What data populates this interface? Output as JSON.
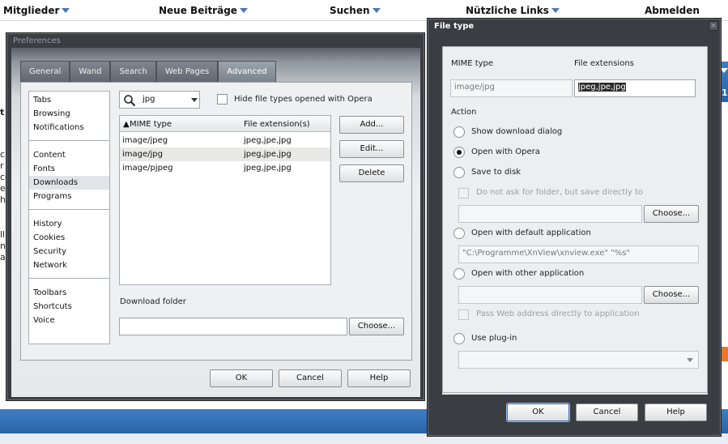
{
  "forum": {
    "nav": [
      "Mitglieder",
      "Neue Beiträge",
      "Suchen",
      "Nützliche Links",
      "Abmelden"
    ],
    "side_fragments": [
      "t",
      "ci",
      "r",
      "ce",
      "er",
      "he",
      "ll",
      "ni",
      "a"
    ],
    "right_number": "1"
  },
  "preferences": {
    "title": "Preferences",
    "tabs": [
      "General",
      "Wand",
      "Search",
      "Web Pages",
      "Advanced"
    ],
    "active_tab": "Advanced",
    "categories": [
      [
        "Tabs",
        "Browsing",
        "Notifications"
      ],
      [
        "Content",
        "Fonts",
        "Downloads",
        "Programs"
      ],
      [
        "History",
        "Cookies",
        "Security",
        "Network"
      ],
      [
        "Toolbars",
        "Shortcuts",
        "Voice"
      ]
    ],
    "selected_category": "Downloads",
    "search_value": "jpg",
    "hide_label": "Hide file types opened with Opera",
    "table": {
      "headers": [
        "MIME type",
        "File extension(s)"
      ],
      "rows": [
        [
          "image/jpeg",
          "jpeg,jpe,jpg"
        ],
        [
          "image/jpg",
          "jpeg,jpe,jpg"
        ],
        [
          "image/pjpeg",
          "jpeg,jpe,jpg"
        ]
      ],
      "selected_row": 1
    },
    "buttons": {
      "add": "Add...",
      "edit": "Edit...",
      "delete": "Delete",
      "choose": "Choose...",
      "ok": "OK",
      "cancel": "Cancel",
      "help": "Help"
    },
    "download_folder_label": "Download folder",
    "download_folder_value": ""
  },
  "file_type": {
    "title": "File type",
    "mime_label": "MIME type",
    "ext_label": "File extensions",
    "mime_value": "image/jpg",
    "ext_value": "jpeg,jpe,jpg",
    "action_label": "Action",
    "options": {
      "show_dialog": "Show download dialog",
      "open_opera": "Open with Opera",
      "save_disk": "Save to disk",
      "no_ask": "Do not ask for folder, but save directly to",
      "open_default": "Open with default application",
      "default_app_value": "\"C:\\Programme\\XnView\\xnview.exe\" \"%s\"",
      "open_other": "Open with other application",
      "pass_web": "Pass Web address directly to application",
      "plugin": "Use plug-in"
    },
    "selected_action": "open_opera",
    "buttons": {
      "choose": "Choose...",
      "ok": "OK",
      "cancel": "Cancel",
      "help": "Help"
    }
  }
}
